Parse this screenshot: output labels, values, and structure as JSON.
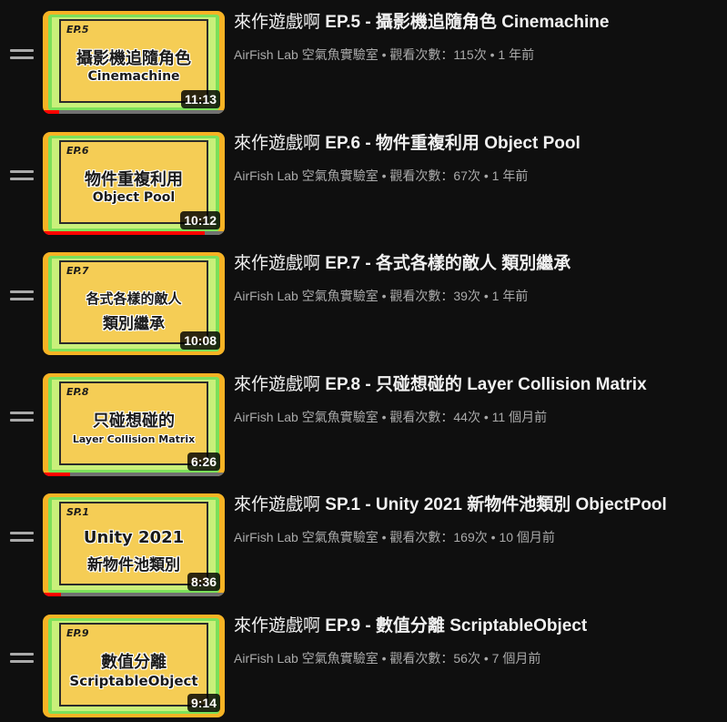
{
  "playlist": {
    "videos": [
      {
        "title_prefix": "來作遊戲啊",
        "title_rest": " EP.5 - 攝影機追隨角色 Cinemachine",
        "channel": "AirFish Lab 空氣魚實驗室",
        "views": "觀看次數：115次",
        "age": "1 年前",
        "thumb_ep": "EP.5",
        "thumb_line1": "攝影機追隨角色",
        "thumb_line2": "Cinemachine",
        "duration": "11:13",
        "watched_fraction": 0.09
      },
      {
        "title_prefix": "來作遊戲啊",
        "title_rest": " EP.6 - 物件重複利用 Object Pool",
        "channel": "AirFish Lab 空氣魚實驗室",
        "views": "觀看次數：67次",
        "age": "1 年前",
        "thumb_ep": "EP.6",
        "thumb_line1": "物件重複利用",
        "thumb_line2": "Object Pool",
        "duration": "10:12",
        "watched_fraction": 0.89
      },
      {
        "title_prefix": "來作遊戲啊",
        "title_rest": " EP.7 - 各式各樣的敵人 類別繼承",
        "channel": "AirFish Lab 空氣魚實驗室",
        "views": "觀看次數：39次",
        "age": "1 年前",
        "thumb_ep": "EP.7",
        "thumb_line1": "各式各樣的敵人",
        "thumb_line2": "類別繼承",
        "duration": "10:08",
        "watched_fraction": 0
      },
      {
        "title_prefix": "來作遊戲啊",
        "title_rest": " EP.8 - 只碰想碰的 Layer Collision Matrix",
        "channel": "AirFish Lab 空氣魚實驗室",
        "views": "觀看次數：44次",
        "age": "11 個月前",
        "thumb_ep": "EP.8",
        "thumb_line1": "只碰想碰的",
        "thumb_line2": "Layer Collision Matrix",
        "duration": "6:26",
        "watched_fraction": 0.15
      },
      {
        "title_prefix": "來作遊戲啊",
        "title_rest": " SP.1 - Unity 2021 新物件池類別 ObjectPool",
        "channel": "AirFish Lab 空氣魚實驗室",
        "views": "觀看次數：169次",
        "age": "10 個月前",
        "thumb_ep": "SP.1",
        "thumb_line1": "Unity 2021",
        "thumb_line2": "新物件池類別",
        "duration": "8:36",
        "watched_fraction": 0.1
      },
      {
        "title_prefix": "來作遊戲啊",
        "title_rest": " EP.9 - 數值分離 ScriptableObject",
        "channel": "AirFish Lab 空氣魚實驗室",
        "views": "觀看次數：56次",
        "age": "7 個月前",
        "thumb_ep": "EP.9",
        "thumb_line1": "數值分離",
        "thumb_line2": "ScriptableObject",
        "duration": "9:14",
        "watched_fraction": 0
      }
    ],
    "separator": " • ",
    "icons": {
      "drag_handle": "drag-handle-icon"
    },
    "colors": {
      "background": "#0f0f0f",
      "title": "#f1f1f1",
      "meta": "#aaaaaa",
      "progress_fill": "#ff0000",
      "thumb_border": "#f6b324",
      "thumb_green": "#7ce05a",
      "thumb_card": "#f5cd55"
    }
  }
}
